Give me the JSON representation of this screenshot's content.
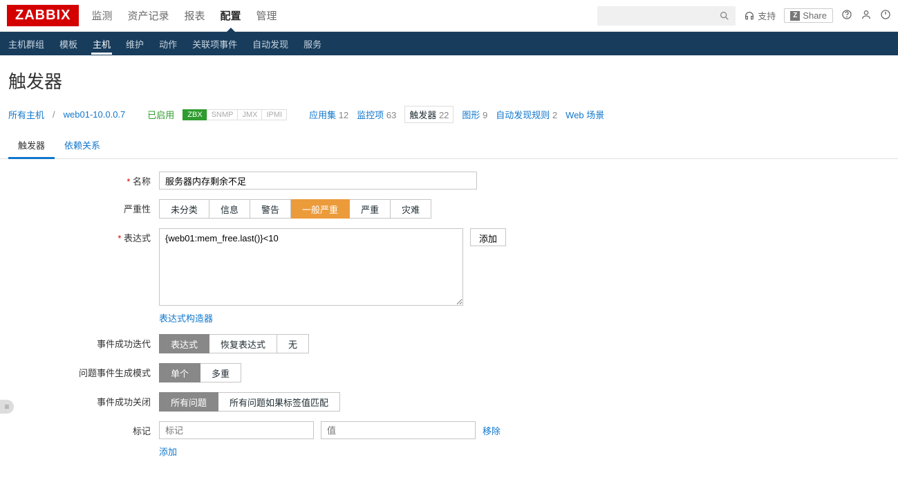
{
  "logo": "ZABBIX",
  "topnav": {
    "items": [
      "监测",
      "资产记录",
      "报表",
      "配置",
      "管理"
    ],
    "activeIndex": 3
  },
  "topright": {
    "support": "支持",
    "share": "Share"
  },
  "subnav": {
    "items": [
      "主机群组",
      "模板",
      "主机",
      "维护",
      "动作",
      "关联项事件",
      "自动发现",
      "服务"
    ],
    "activeIndex": 2
  },
  "pageTitle": "触发器",
  "crumb": {
    "allHosts": "所有主机",
    "hostName": "web01-10.0.0.7",
    "enabled": "已启用",
    "zbx": "ZBX",
    "snmp": "SNMP",
    "jmx": "JMX",
    "ipmi": "IPMI",
    "apps": {
      "label": "应用集",
      "count": "12"
    },
    "items": {
      "label": "监控项",
      "count": "63"
    },
    "triggers": {
      "label": "触发器",
      "count": "22"
    },
    "graphs": {
      "label": "图形",
      "count": "9"
    },
    "discovery": {
      "label": "自动发现规则",
      "count": "2"
    },
    "web": {
      "label": "Web 场景"
    }
  },
  "tabs": {
    "trigger": "触发器",
    "deps": "依赖关系"
  },
  "form": {
    "nameLabel": "名称",
    "nameValue": "服务器内存剩余不足",
    "severityLabel": "严重性",
    "severityOptions": [
      "未分类",
      "信息",
      "警告",
      "一般严重",
      "严重",
      "灾难"
    ],
    "severitySelected": 3,
    "exprLabel": "表达式",
    "exprValue": "{web01:mem_free.last()}<10",
    "addBtn": "添加",
    "exprBuilder": "表达式构造器",
    "okEventLabel": "事件成功迭代",
    "okEventOptions": [
      "表达式",
      "恢复表达式",
      "无"
    ],
    "okEventSelected": 0,
    "probGenLabel": "问题事件生成模式",
    "probGenOptions": [
      "单个",
      "多重"
    ],
    "probGenSelected": 0,
    "okCloseLabel": "事件成功关闭",
    "okCloseOptions": [
      "所有问题",
      "所有问题如果标签值匹配"
    ],
    "okCloseSelected": 0,
    "tagLabel": "标记",
    "tagKeyPlaceholder": "标记",
    "tagValPlaceholder": "值",
    "tagRemove": "移除",
    "tagAdd": "添加"
  }
}
